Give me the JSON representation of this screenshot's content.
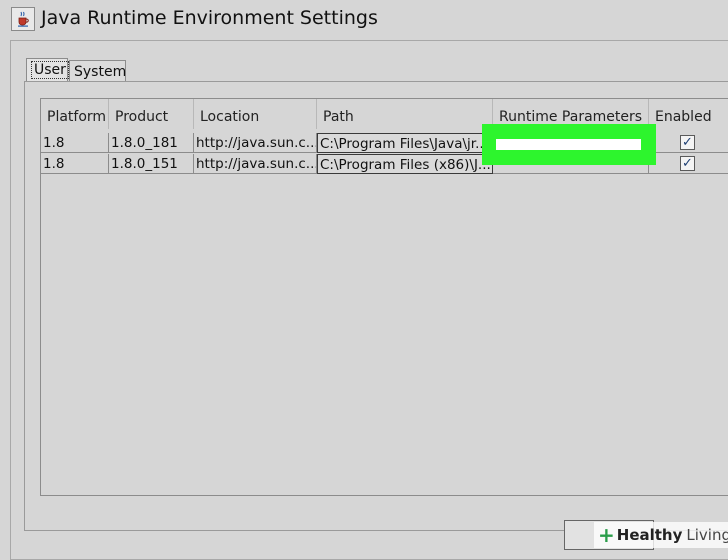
{
  "window": {
    "title": "Java Runtime Environment Settings",
    "icon": "java-cup-icon"
  },
  "tabs": [
    {
      "label": "User",
      "selected": true
    },
    {
      "label": "System",
      "selected": false
    }
  ],
  "table": {
    "columns": [
      "Platform",
      "Product",
      "Location",
      "Path",
      "Runtime Parameters",
      "Enabled"
    ],
    "rows": [
      {
        "platform": "1.8",
        "product": "1.8.0_181",
        "location": "http://java.sun.c...",
        "path": "C:\\Program Files\\Java\\jr...",
        "runtime_parameters": "",
        "enabled": true
      },
      {
        "platform": "1.8",
        "product": "1.8.0_151",
        "location": "http://java.sun.c...",
        "path": "C:\\Program Files (x86)\\J...",
        "runtime_parameters": "",
        "enabled": true
      }
    ]
  },
  "highlight_color": "#2df52d",
  "watermark": {
    "brand": "Healthy",
    "suffix": "Living"
  }
}
